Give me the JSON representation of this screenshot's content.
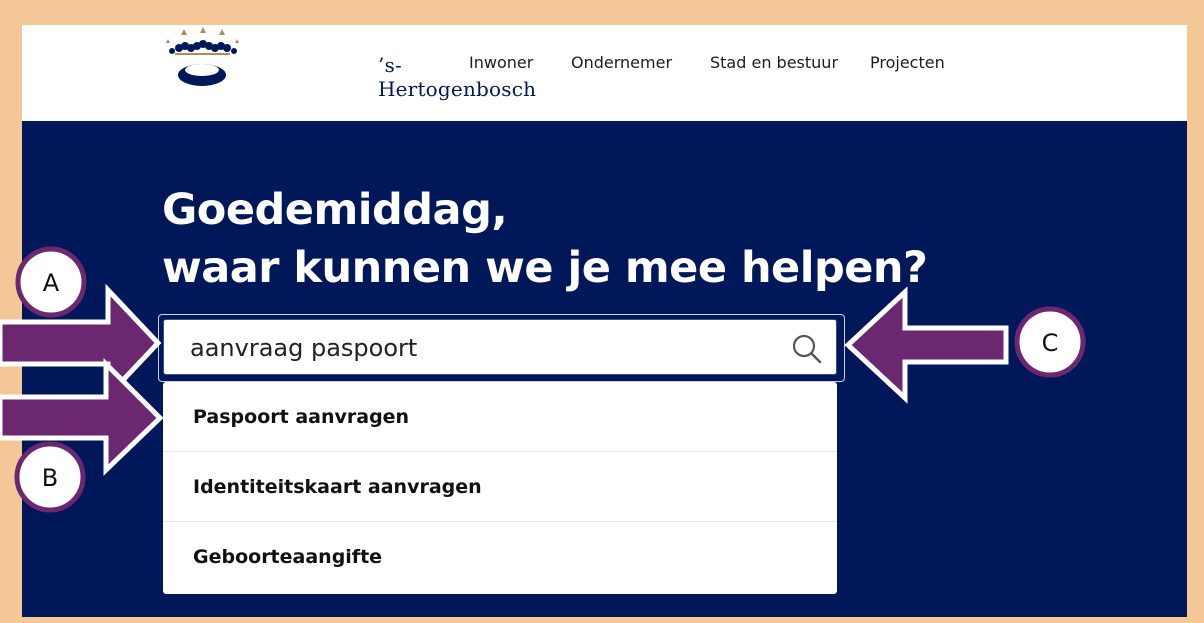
{
  "header": {
    "site_name": "’s-Hertogenbosch",
    "nav": [
      "Inwoner",
      "Ondernemer",
      "Stad en bestuur",
      "Projecten"
    ]
  },
  "hero": {
    "greeting": "Goedemiddag,",
    "question": "waar kunnen we je mee helpen?"
  },
  "search": {
    "value": "aanvraag paspoort",
    "icon": "search-icon"
  },
  "suggestions": [
    "Paspoort aanvragen",
    "Identiteitskaart aanvragen",
    "Geboorteaangifte"
  ],
  "annotations": {
    "labels": [
      "A",
      "B",
      "C"
    ],
    "arrow_color": "#6b2870"
  },
  "colors": {
    "frame": "#f3c896",
    "hero_background": "#00185a",
    "logo_navy": "#00185a",
    "logo_gold": "#b08d57"
  }
}
